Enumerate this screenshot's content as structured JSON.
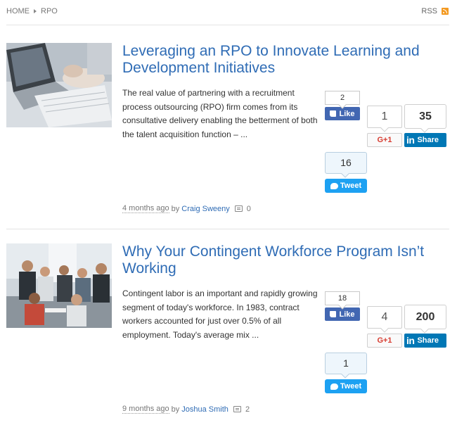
{
  "breadcrumb": {
    "home": "HOME",
    "current": "RPO"
  },
  "rss": {
    "label": "RSS"
  },
  "colors": {
    "link": "#2f6cb5",
    "facebook": "#4267b2",
    "linkedin": "#0077b5",
    "twitter": "#1da1f2",
    "googleplus": "#d73d32",
    "rss": "#f39a22"
  },
  "posts": [
    {
      "title": "Leveraging an RPO to Innovate Learning and Development Initiatives",
      "excerpt": "The real value of partnering with a recruitment process outsourcing (RPO) firm comes from its consultative delivery enabling the betterment of both the talent acquisition function – ...",
      "time": "4 months ago",
      "by": "by",
      "author": "Craig Sweeny",
      "comments": "0",
      "share": {
        "facebook_count": "2",
        "facebook_label": "Like",
        "gplus_count": "1",
        "gplus_label": "G+1",
        "linkedin_count": "35",
        "linkedin_label": "Share",
        "twitter_count": "16",
        "twitter_label": "Tweet"
      }
    },
    {
      "title": "Why Your Contingent Workforce Program Isn’t Working",
      "excerpt": "Contingent labor is an important and rapidly growing segment of today's workforce. In 1983, contract workers accounted for just over 0.5% of all employment. Today's average mix ...",
      "time": "9 months ago",
      "by": "by",
      "author": "Joshua Smith",
      "comments": "2",
      "share": {
        "facebook_count": "18",
        "facebook_label": "Like",
        "gplus_count": "4",
        "gplus_label": "G+1",
        "linkedin_count": "200",
        "linkedin_label": "Share",
        "twitter_count": "1",
        "twitter_label": "Tweet"
      }
    }
  ]
}
